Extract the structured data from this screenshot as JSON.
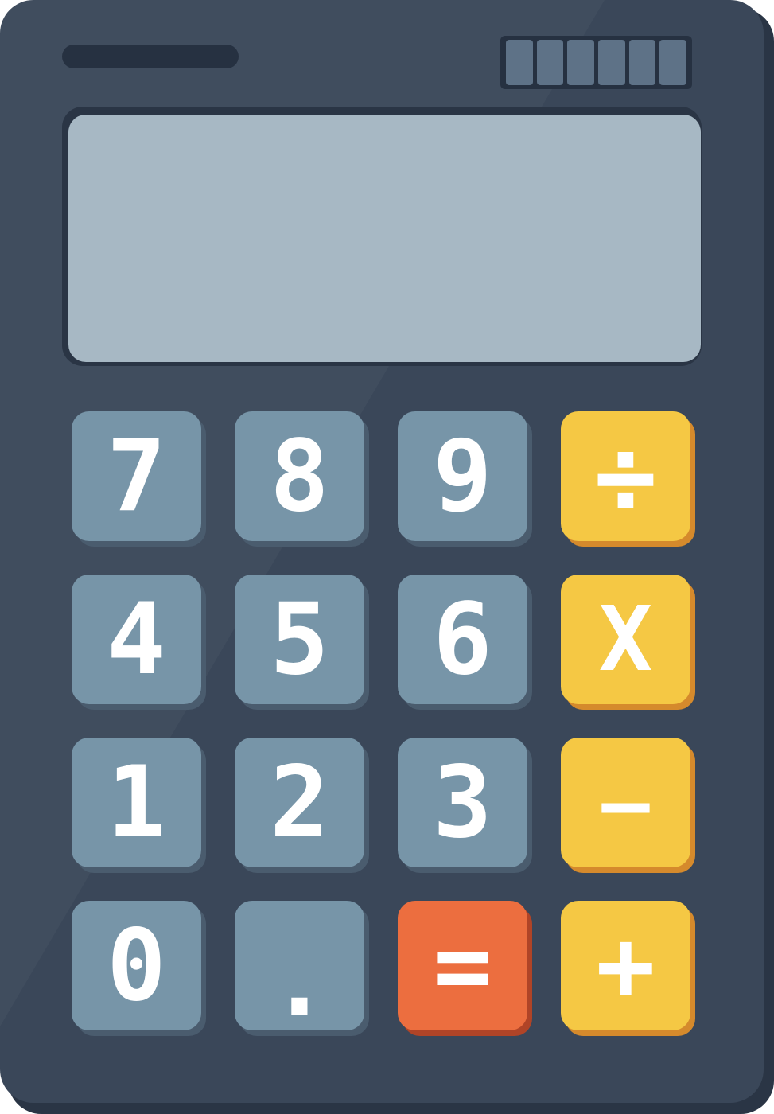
{
  "display": {
    "value": ""
  },
  "keys": {
    "seven": "7",
    "eight": "8",
    "nine": "9",
    "divide": "÷",
    "four": "4",
    "five": "5",
    "six": "6",
    "multiply": "X",
    "one": "1",
    "two": "2",
    "three": "3",
    "subtract": "—",
    "zero": "0",
    "decimal": ".",
    "equals": "=",
    "add": "+"
  },
  "colors": {
    "body": "#3a4759",
    "display": "#a7b8c4",
    "number_key": "#7795a8",
    "operator_key": "#f5c844",
    "equals_key": "#ec6e3f",
    "key_text": "#ffffff"
  }
}
